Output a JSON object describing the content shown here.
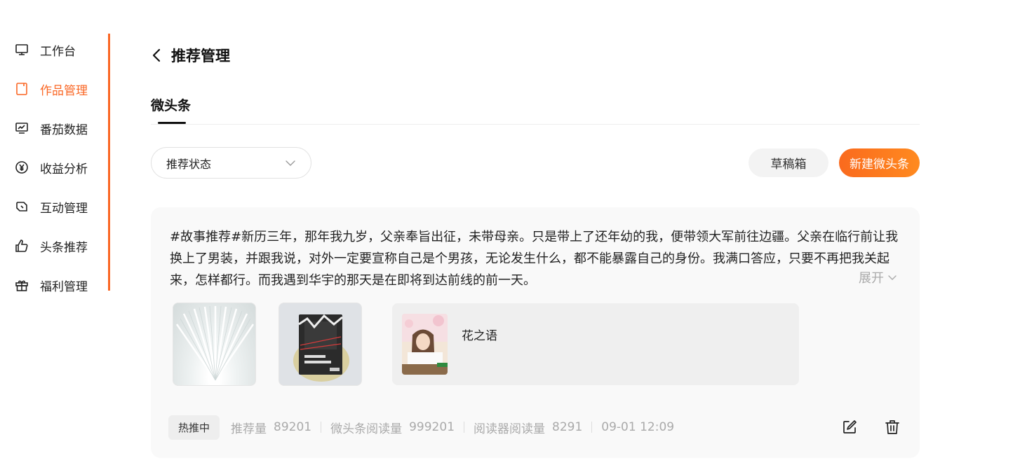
{
  "sidebar": {
    "items": [
      {
        "label": "工作台",
        "icon": "monitor-icon",
        "active": false
      },
      {
        "label": "作品管理",
        "icon": "document-icon",
        "active": true
      },
      {
        "label": "番茄数据",
        "icon": "chart-screen-icon",
        "active": false
      },
      {
        "label": "收益分析",
        "icon": "yen-circle-icon",
        "active": false
      },
      {
        "label": "互动管理",
        "icon": "chat-bubble-icon",
        "active": false
      },
      {
        "label": "头条推荐",
        "icon": "thumbs-up-icon",
        "active": false
      },
      {
        "label": "福利管理",
        "icon": "gift-icon",
        "active": false
      }
    ],
    "accent_color": "#fa6725"
  },
  "header": {
    "title": "推荐管理"
  },
  "tabs": [
    {
      "label": "微头条",
      "active": true
    }
  ],
  "filter": {
    "status_select": "推荐状态"
  },
  "actions": {
    "draft_label": "草稿箱",
    "new_label": "新建微头条"
  },
  "post": {
    "text": "#故事推荐#新历三年，那年我九岁，父亲奉旨出征，未带母亲。只是带上了还年幼的我，便带领大军前往边疆。父亲在临行前让我换上了男装，并跟我说，对外一定要宣称自己是个男孩，无论发生什么，都不能暴露自己的身份。我满口答应，只要不再把我关起来，怎样都行。而我遇到华宇的那天是在即将到达前线的前一天。",
    "expand_label": "展开",
    "book": {
      "name": "花之语"
    },
    "status_badge": "热推中",
    "stats": [
      {
        "label": "推荐量",
        "value": "89201"
      },
      {
        "label": "微头条阅读量",
        "value": "999201"
      },
      {
        "label": "阅读器阅读量",
        "value": "8291"
      }
    ],
    "time": "09-01 12:09"
  }
}
